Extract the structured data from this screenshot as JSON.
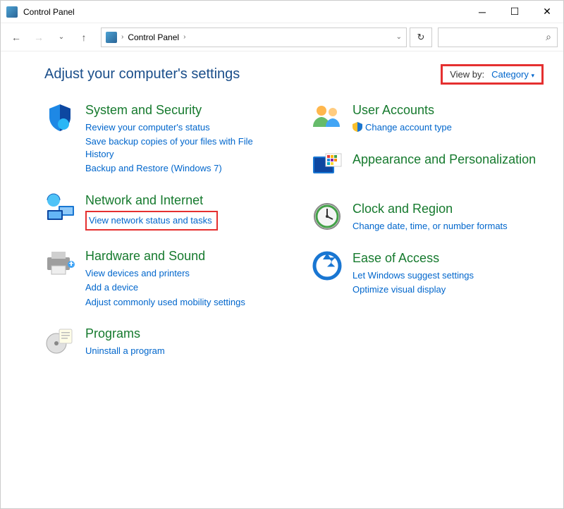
{
  "window": {
    "title": "Control Panel"
  },
  "breadcrumb": {
    "root": "Control Panel"
  },
  "header": {
    "page_title": "Adjust your computer's settings",
    "viewby_label": "View by:",
    "viewby_value": "Category"
  },
  "categories": {
    "system_security": {
      "title": "System and Security",
      "links": [
        "Review your computer's status",
        "Save backup copies of your files with File History",
        "Backup and Restore (Windows 7)"
      ]
    },
    "network": {
      "title": "Network and Internet",
      "links": [
        "View network status and tasks"
      ]
    },
    "hardware": {
      "title": "Hardware and Sound",
      "links": [
        "View devices and printers",
        "Add a device",
        "Adjust commonly used mobility settings"
      ]
    },
    "programs": {
      "title": "Programs",
      "links": [
        "Uninstall a program"
      ]
    },
    "user_accounts": {
      "title": "User Accounts",
      "links": [
        "Change account type"
      ]
    },
    "appearance": {
      "title": "Appearance and Personalization",
      "links": []
    },
    "clock": {
      "title": "Clock and Region",
      "links": [
        "Change date, time, or number formats"
      ]
    },
    "ease": {
      "title": "Ease of Access",
      "links": [
        "Let Windows suggest settings",
        "Optimize visual display"
      ]
    }
  }
}
